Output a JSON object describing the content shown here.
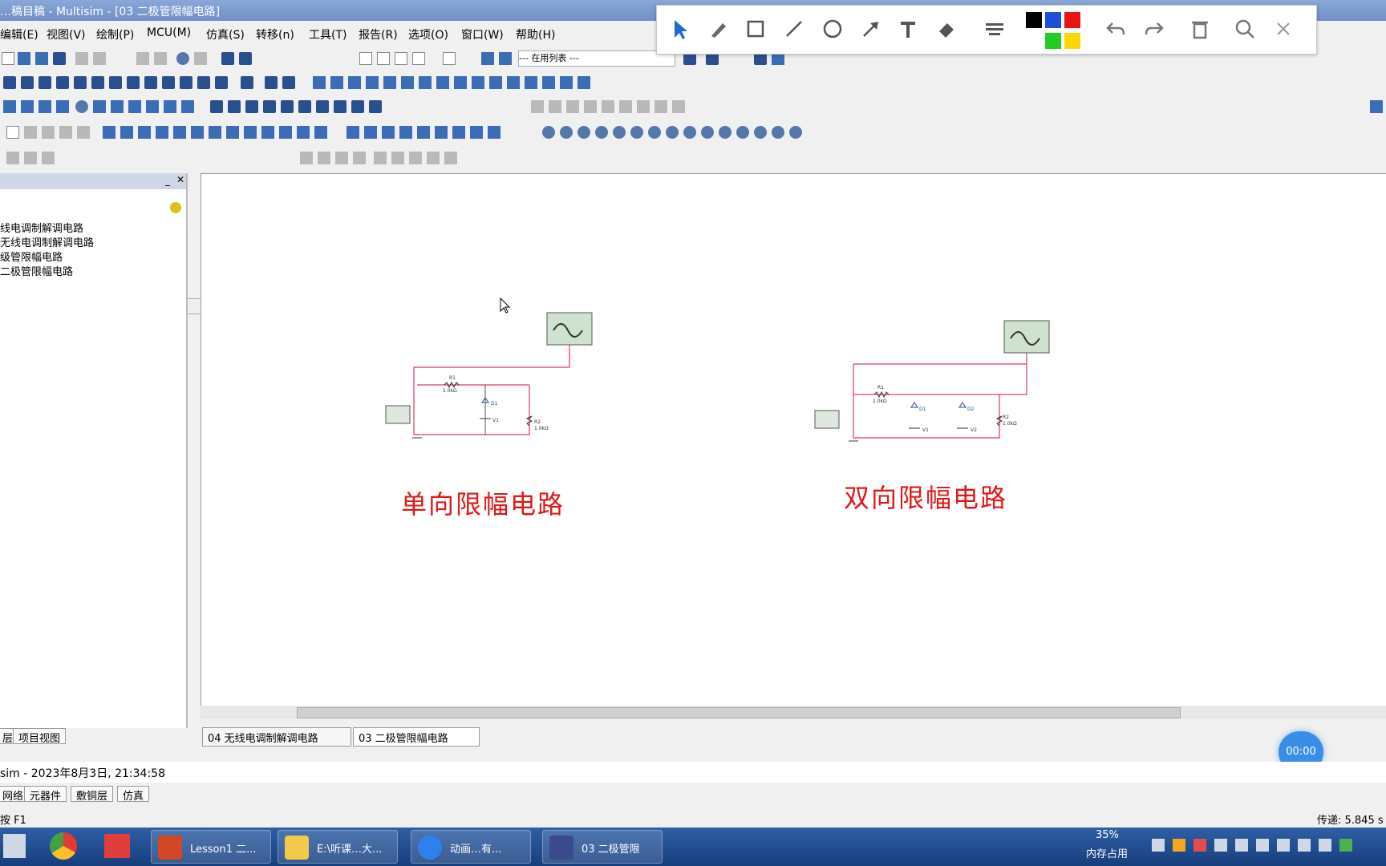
{
  "window": {
    "title": "…稿目稿 - Multisim - [03 二极管限幅电路]"
  },
  "menu": {
    "items": [
      "编辑(E)",
      "视图(V)",
      "绘制(P)",
      "MCU(M)",
      "仿真(S)",
      "转移(n)",
      "工具(T)",
      "报告(R)",
      "选项(O)",
      "窗口(W)",
      "帮助(H)"
    ]
  },
  "toolbar": {
    "in_use_list": "--- 在用列表 ---"
  },
  "annotation_bar": {
    "tools": [
      "select-icon",
      "pen-icon",
      "rectangle-icon",
      "line-icon",
      "circle-icon",
      "arrow-icon",
      "text-icon",
      "eraser-icon",
      "highlighter-icon",
      "undo-icon",
      "redo-icon",
      "delete-icon",
      "zoom-icon",
      "close-icon"
    ],
    "colors": [
      "#000000",
      "#1f4fd6",
      "#e81515",
      "#ffffff",
      "#22cc22",
      "#ffd700"
    ]
  },
  "design_toolbox": {
    "items": [
      "线电调制解调电路",
      "无线电调制解调电路",
      "级管限幅电路",
      "二极管限幅电路"
    ]
  },
  "canvas": {
    "circuit1": {
      "title": "单向限幅电路",
      "r1_label": "R1",
      "r1_value": "1.0kΩ",
      "r2_label": "R2",
      "r2_value": "1.0kΩ",
      "d_label": "D1",
      "v_label": "V1"
    },
    "circuit2": {
      "title": "双向限幅电路",
      "r1_label": "R1",
      "r1_value": "1.0kΩ",
      "r2_label": "R2",
      "r2_value": "1.0kΩ",
      "d1_label": "D1",
      "d2_label": "D2",
      "v1_label": "V1",
      "v2_label": "V2"
    }
  },
  "doc_tabs": [
    "04 无线电调制解调电路",
    "03 二极管限幅电路"
  ],
  "panel_tabs": {
    "project_view": "项目视图",
    "prefix": "层"
  },
  "status_line": {
    "text": "sim  -  2023年8月3日, 21:34:58"
  },
  "bottom_tabs": [
    "网络",
    "元器件",
    "敷铜层",
    "仿真"
  ],
  "status_bar": {
    "help": "按 F1",
    "transfer": "传递: 5.845 s"
  },
  "timer": {
    "value": "00:00"
  },
  "taskbar": {
    "buttons": [
      "Lesson1 二...",
      "E:\\听课…大...",
      "动画…有...",
      "03 二极管限"
    ],
    "memory_percent": "35%",
    "memory_label": "内存占用"
  }
}
